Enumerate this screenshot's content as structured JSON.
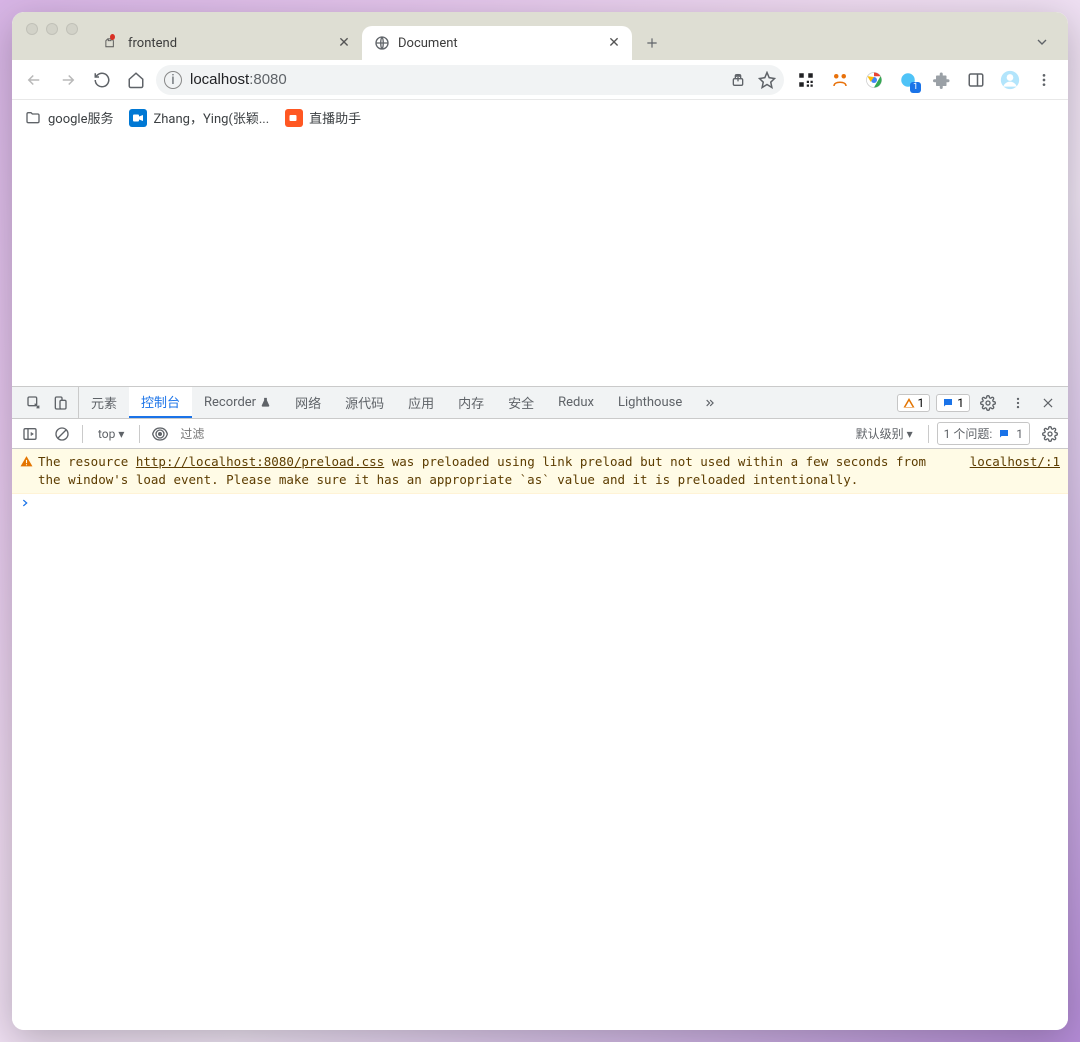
{
  "tabs": [
    {
      "title": "frontend"
    },
    {
      "title": "Document"
    }
  ],
  "omnibox": {
    "host": "localhost",
    "port": ":8080"
  },
  "bookmarks": [
    {
      "label": "google服务"
    },
    {
      "label": "Zhang，Ying(张颖..."
    },
    {
      "label": "直播助手"
    }
  ],
  "extension_badge": "1",
  "devtools": {
    "tabs": {
      "elements": "元素",
      "console": "控制台",
      "recorder": "Recorder",
      "network": "网络",
      "sources": "源代码",
      "application": "应用",
      "memory": "内存",
      "security": "安全",
      "redux": "Redux",
      "lighthouse": "Lighthouse"
    },
    "warnings_count": "1",
    "messages_count": "1",
    "console_toolbar": {
      "context": "top",
      "filter_placeholder": "过滤",
      "levels": "默认级别",
      "issues_label": "1 个问题:",
      "issues_count": "1"
    },
    "console_message": {
      "prefix": "The resource ",
      "link": "http://localhost:8080/preload.css",
      "suffix": " was preloaded using link preload but not used within a few seconds from the window's load event. Please make sure it has an appropriate `as` value and it is preloaded intentionally.",
      "source": "localhost/:1"
    }
  }
}
